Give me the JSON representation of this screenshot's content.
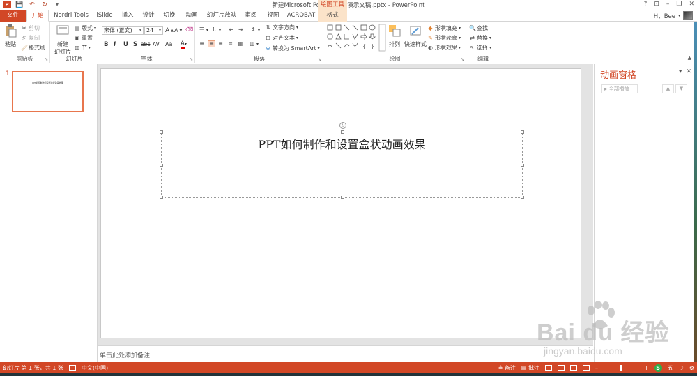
{
  "titlebar": {
    "title": "新建Microsoft PowerPoint 演示文稿.pptx - PowerPoint",
    "contextual_tool": "绘图工具",
    "help": "?",
    "ribbon_display": "⊡",
    "minimize": "–",
    "restore": "❐",
    "close": "✕"
  },
  "tabs": [
    "文件",
    "开始",
    "Nordri Tools",
    "iSlide",
    "插入",
    "设计",
    "切换",
    "动画",
    "幻灯片放映",
    "审阅",
    "视图",
    "ACROBAT",
    "格式"
  ],
  "user": {
    "name": "H、Bee",
    "arrow": "▾"
  },
  "ribbon": {
    "clipboard": {
      "label": "剪贴板",
      "paste": "粘贴",
      "cut": "剪切",
      "copy": "复制",
      "format_painter": "格式刷"
    },
    "slides": {
      "label": "幻灯片",
      "new_slide": "新建",
      "new_slide_2": "幻灯片",
      "layout": "版式",
      "reset": "重置",
      "section": "节"
    },
    "font": {
      "label": "字体",
      "font_name": "宋体 (正文)",
      "font_size": "24",
      "bold": "B",
      "italic": "I",
      "underline": "U",
      "shadow": "S",
      "strike": "abc",
      "spacing": "AV",
      "case": "Aa",
      "color": "A",
      "grow": "A",
      "shrink": "A"
    },
    "paragraph": {
      "label": "段落",
      "text_direction": "文字方向",
      "align_text": "对齐文本",
      "smartart": "转换为 SmartArt"
    },
    "drawing": {
      "label": "绘图",
      "arrange": "排列",
      "quick_styles": "快速样式",
      "shape_fill": "形状填充",
      "shape_outline": "形状轮廓",
      "shape_effects": "形状效果"
    },
    "editing": {
      "label": "编辑",
      "find": "查找",
      "replace": "替换",
      "select": "选择"
    }
  },
  "slide_pane": {
    "slide_number": "1",
    "thumb_text": "PPT如何制作和设置盒状动画效果"
  },
  "slide": {
    "title": "PPT如何制作和设置盒状动画效果"
  },
  "notes": {
    "placeholder": "单击此处添加备注"
  },
  "animation_pane": {
    "title": "动画窗格",
    "play_all": "全部播放",
    "dropdown": "▾",
    "close": "✕",
    "up": "▲",
    "down": "▼"
  },
  "watermark": {
    "logo": "Bai du 经验",
    "url": "jingyan.baidu.com"
  },
  "statusbar": {
    "slide_info": "幻灯片 第 1 张，共 1 张",
    "language": "中文(中国)",
    "notes": "备注",
    "comments": "批注",
    "zoom_minus": "–",
    "zoom_plus": "+"
  },
  "colors": {
    "accent": "#d24726",
    "contextual_bg": "#fbe3c9",
    "thumb_border": "#e8764d"
  }
}
